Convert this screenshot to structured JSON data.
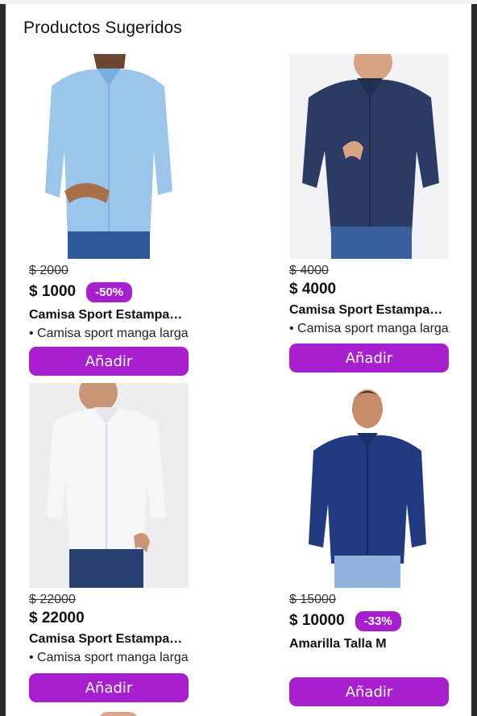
{
  "section": {
    "title": "Productos Sugeridos"
  },
  "colors": {
    "accent": "#a71fcf"
  },
  "products": [
    {
      "old_price": "$ 2000",
      "price": "$ 1000",
      "discount": "-50%",
      "name": "Camisa Sport Estampada Manga Larga",
      "description": "• Camisa sport manga larga",
      "button": "Añadir",
      "image": "light-blue-patterned-shirt-photo"
    },
    {
      "old_price": "$ 4000",
      "price": "$ 4000",
      "discount": "",
      "name": "Camisa Sport Estampada Manga Larga",
      "description": "• Camisa sport manga larga",
      "button": "Añadir",
      "image": "navy-dotted-shirt-photo"
    },
    {
      "old_price": "$ 22000",
      "price": "$ 22000",
      "discount": "",
      "name": "Camisa Sport Estampada Manga Larga",
      "description": "• Camisa sport manga larga",
      "button": "Añadir",
      "image": "white-patterned-shirt-photo"
    },
    {
      "old_price": "$ 15000",
      "price": "$ 10000",
      "discount": "-33%",
      "name": "Amarilla Talla M",
      "description": "",
      "button": "Añadir",
      "image": "navy-solid-shirt-photo"
    }
  ]
}
